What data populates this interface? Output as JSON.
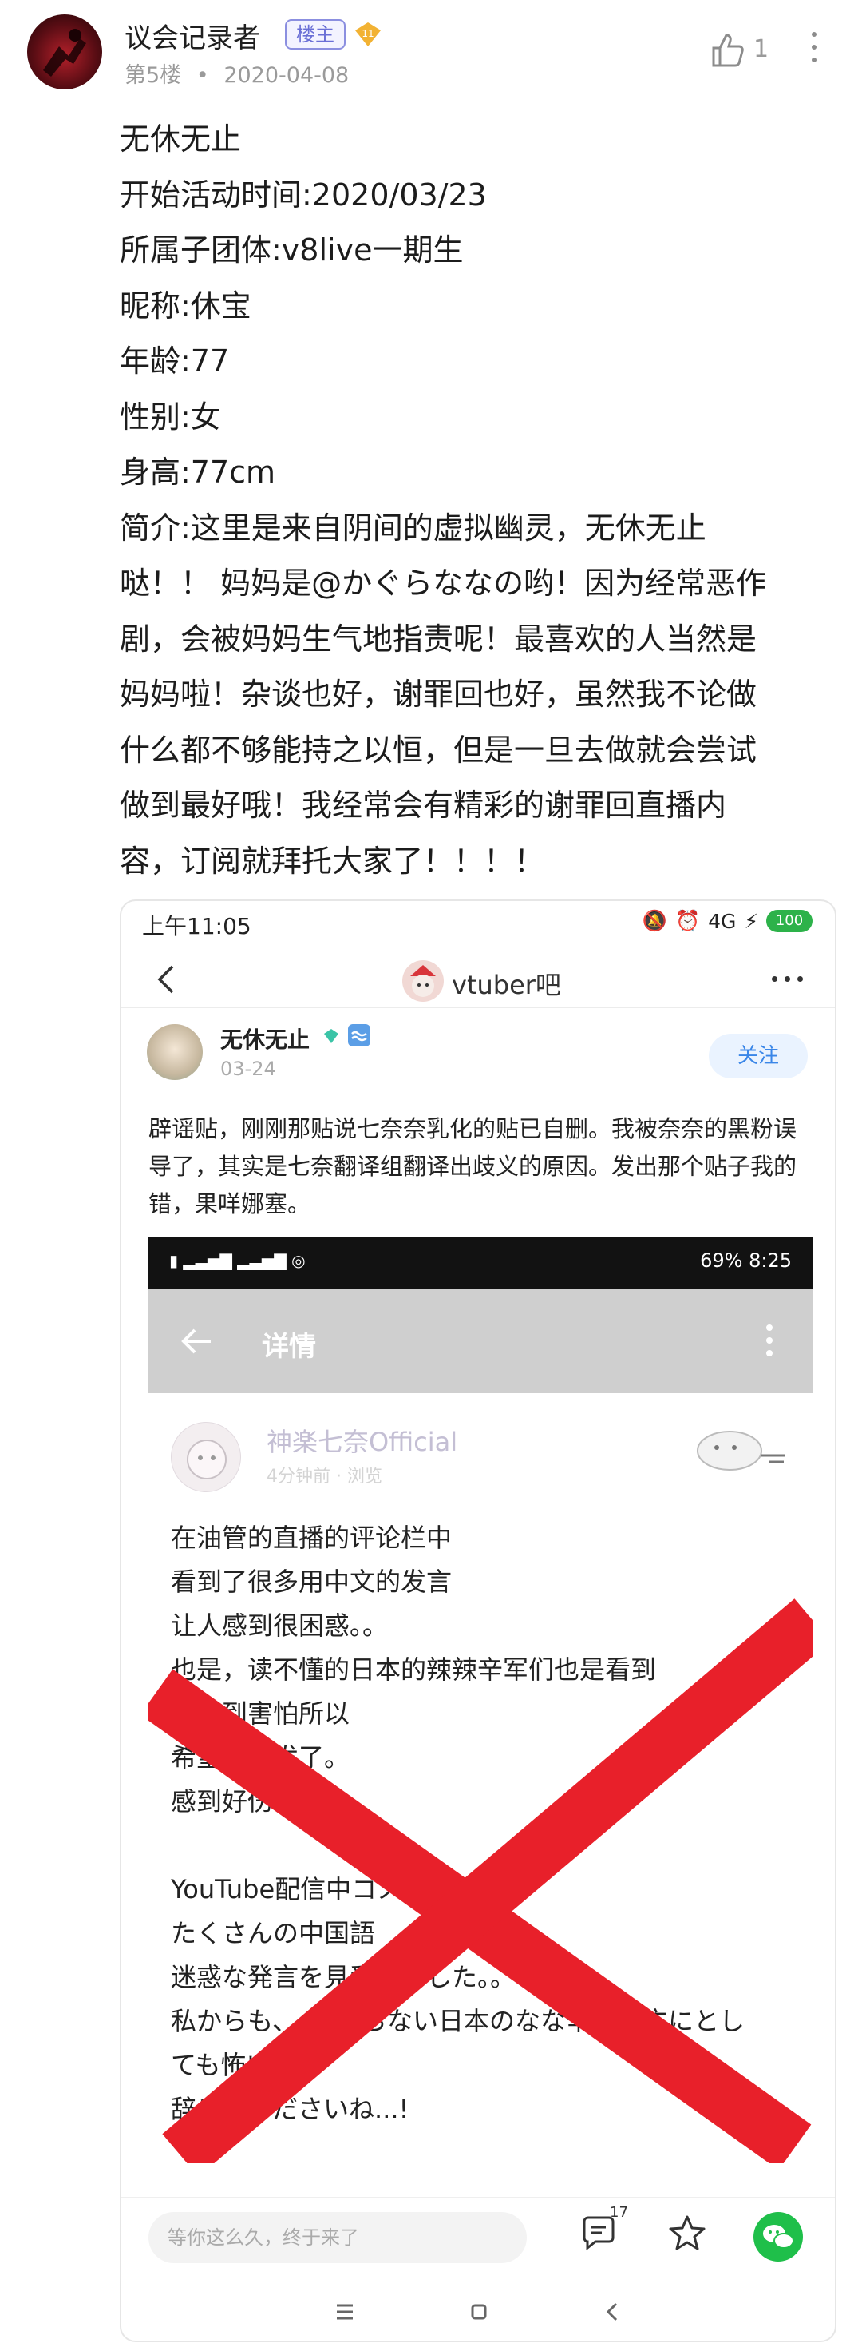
{
  "post": {
    "username": "议会记录者",
    "owner_badge": "楼主",
    "level": "11",
    "floor": "第5楼",
    "separator": "•",
    "date": "2020-04-08",
    "like_count": "1",
    "body_lines": [
      "无休无止",
      "开始活动时间:2020/03/23",
      "所属子团体:v8live一期生",
      "昵称:休宝",
      "年龄:77",
      "性别:女",
      "身高:77cm"
    ],
    "intro_lines": [
      "简介:这里是来自阴间的虚拟幽灵，无休无止",
      "哒！！ 妈妈是@かぐらななの哟！因为经常恶作",
      "剧，会被妈妈生气地指责呢！最喜欢的人当然是",
      "妈妈啦！杂谈也好，谢罪回也好，虽然我不论做",
      "什么都不够能持之以恒，但是一旦去做就会尝试",
      "做到最好哦！我经常会有精彩的谢罪回直播内",
      "容，订阅就拜托大家了！！！！"
    ]
  },
  "embed": {
    "status_time": "上午11:05",
    "status_icons": "4G",
    "battery": "100",
    "forum_name": "vtuber吧",
    "user_name": "无休无止",
    "user_date": "03-24",
    "follow_label": "关注",
    "text": "辟谣贴，刚刚那贴说七奈奈乳化的贴已自删。我被奈奈的黑粉误导了，其实是七奈翻译组翻译出歧义的原因。发出那个贴子我的错，果咩娜塞。",
    "inner": {
      "status_right": "69%  8:25",
      "title": "详情",
      "name": "神楽七奈Official",
      "meta": "4分钟前 · 浏览",
      "lines": [
        "在油管的直播的评论栏中",
        "看到了很多用中文的发言",
        "让人感到很困惑。。",
        "也是，读不懂的日本的辣辣辛军们也是看到",
        "会感到害怕所以",
        "希望不要发了。",
        "感到好伤心..",
        "",
        "YouTube配信中コメ　にて",
        "たくさんの中国語",
        "迷惑な発言を見受けました。。",
        "私からも、　わからない日本のなな辛軍の方にとし",
        "ても怖いので",
        "辞めてくださいね...!"
      ]
    },
    "comment_placeholder": "等你这么久，终于来了",
    "comment_count": "17"
  },
  "colors": {
    "badge_purple": "#6a6fd6",
    "level_orange": "#f2b233",
    "cross_red": "#e8202a",
    "follow_blue": "#3a86e8",
    "wechat_green": "#1fbf4a"
  }
}
